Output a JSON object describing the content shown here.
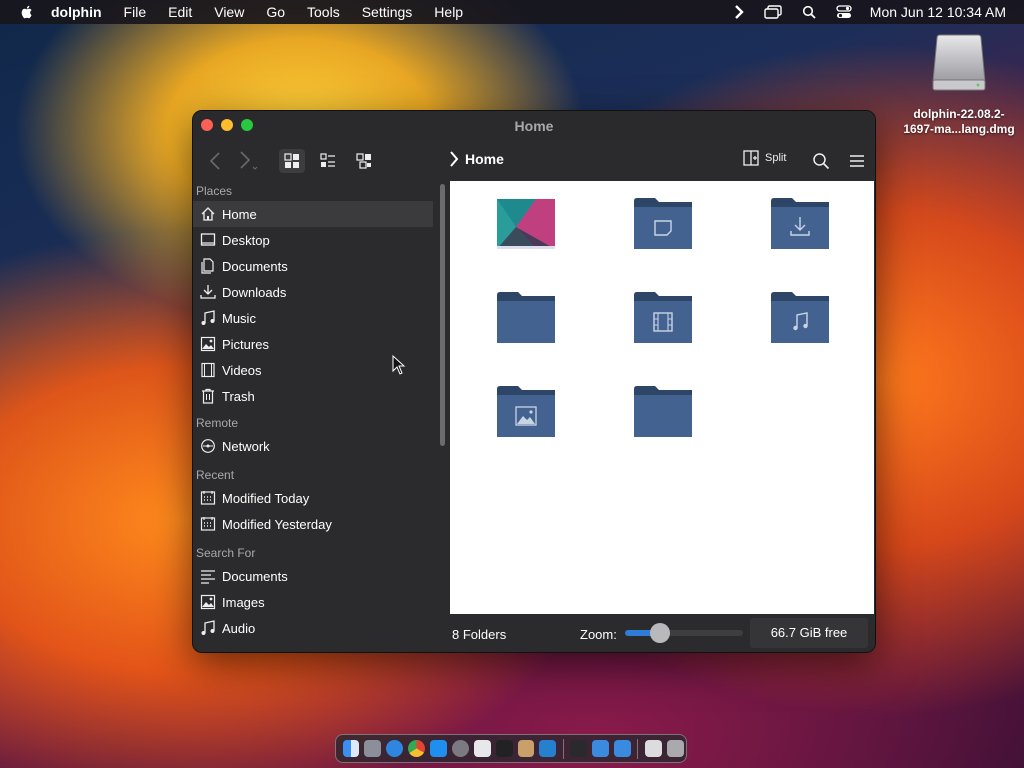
{
  "menubar": {
    "app_name": "dolphin",
    "menus": [
      "File",
      "Edit",
      "View",
      "Go",
      "Tools",
      "Settings",
      "Help"
    ],
    "clock": "Mon Jun 12  10:34 AM"
  },
  "desktop": {
    "disk_label": "dolphin-22.08.2-1697-ma...lang.dmg"
  },
  "window": {
    "title": "Home",
    "breadcrumb": "Home",
    "split_label": "Split"
  },
  "sidebar": {
    "sections": [
      {
        "label": "Places",
        "items": [
          {
            "label": "Home",
            "icon": "home-icon",
            "selected": true
          },
          {
            "label": "Desktop",
            "icon": "desktop-icon"
          },
          {
            "label": "Documents",
            "icon": "documents-icon"
          },
          {
            "label": "Downloads",
            "icon": "downloads-icon"
          },
          {
            "label": "Music",
            "icon": "music-icon"
          },
          {
            "label": "Pictures",
            "icon": "pictures-icon"
          },
          {
            "label": "Videos",
            "icon": "videos-icon"
          },
          {
            "label": "Trash",
            "icon": "trash-icon"
          }
        ]
      },
      {
        "label": "Remote",
        "items": [
          {
            "label": "Network",
            "icon": "network-icon"
          }
        ]
      },
      {
        "label": "Recent",
        "items": [
          {
            "label": "Modified Today",
            "icon": "calendar-icon"
          },
          {
            "label": "Modified Yesterday",
            "icon": "calendar-icon"
          }
        ]
      },
      {
        "label": "Search For",
        "items": [
          {
            "label": "Documents",
            "icon": "documents-search-icon"
          },
          {
            "label": "Images",
            "icon": "images-icon"
          },
          {
            "label": "Audio",
            "icon": "audio-icon"
          }
        ]
      }
    ]
  },
  "content": {
    "folders": [
      {
        "kind": "desktop-wallpaper"
      },
      {
        "kind": "documents"
      },
      {
        "kind": "downloads"
      },
      {
        "kind": "plain"
      },
      {
        "kind": "videos"
      },
      {
        "kind": "music"
      },
      {
        "kind": "pictures"
      },
      {
        "kind": "plain"
      }
    ]
  },
  "statusbar": {
    "count": "8 Folders",
    "zoom_label": "Zoom:",
    "zoom_level": 0.3,
    "free_space": "66.7 GiB free"
  },
  "colors": {
    "folder": "#44628f",
    "folder_tab": "#2d4668",
    "accent": "#2f7bd8"
  }
}
